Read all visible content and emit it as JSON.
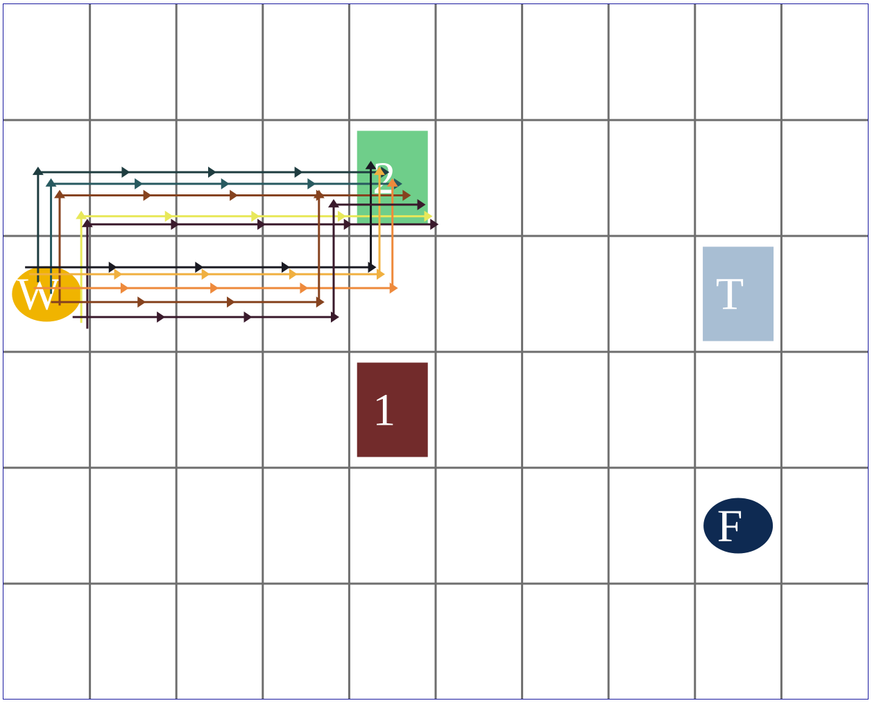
{
  "grid": {
    "cols": 10,
    "rows": 6,
    "border_color": "#1a1aa0",
    "line_color": "#6e6e6e"
  },
  "pieces": [
    {
      "id": "piece-w",
      "label": "W",
      "shape": "ellipse",
      "fill": "#f0b400",
      "text_color": "#ffffff",
      "cell": [
        0,
        2
      ]
    },
    {
      "id": "piece-2",
      "label": "2",
      "shape": "rect",
      "fill": "#6fce8a",
      "text_color": "#ffffff",
      "cell": [
        4,
        1
      ]
    },
    {
      "id": "piece-t",
      "label": "T",
      "shape": "rect",
      "fill": "#a8bed3",
      "text_color": "#ffffff",
      "cell": [
        8,
        2
      ]
    },
    {
      "id": "piece-1",
      "label": "1",
      "shape": "rect",
      "fill": "#722b2b",
      "text_color": "#ffffff",
      "cell": [
        4,
        3
      ]
    },
    {
      "id": "piece-f",
      "label": "F",
      "shape": "ellipse",
      "fill": "#0e2a52",
      "text_color": "#ffffff",
      "cell": [
        8,
        4
      ]
    }
  ],
  "paths": [
    {
      "color": "#1f3d40",
      "points": [
        [
          0.4,
          2.4
        ],
        [
          0.4,
          1.45
        ],
        [
          4.4,
          1.45
        ]
      ]
    },
    {
      "color": "#285a60",
      "points": [
        [
          0.55,
          2.5
        ],
        [
          0.55,
          1.55
        ],
        [
          4.55,
          1.55
        ]
      ]
    },
    {
      "color": "#86431f",
      "points": [
        [
          0.65,
          2.6
        ],
        [
          0.65,
          1.65
        ],
        [
          4.65,
          1.65
        ]
      ]
    },
    {
      "color": "#e8e85a",
      "points": [
        [
          0.9,
          2.75
        ],
        [
          0.9,
          1.83
        ],
        [
          4.9,
          1.83
        ]
      ]
    },
    {
      "color": "#3a1a2c",
      "points": [
        [
          0.97,
          2.8
        ],
        [
          0.97,
          1.9
        ],
        [
          4.97,
          1.9
        ]
      ]
    },
    {
      "color": "#1a1a22",
      "points": [
        [
          0.25,
          2.27
        ],
        [
          4.25,
          2.27
        ],
        [
          4.25,
          1.4
        ]
      ]
    },
    {
      "color": "#f0b040",
      "points": [
        [
          0.3,
          2.33
        ],
        [
          4.35,
          2.33
        ],
        [
          4.35,
          1.45
        ]
      ]
    },
    {
      "color": "#ee8a3c",
      "points": [
        [
          0.35,
          2.45
        ],
        [
          4.5,
          2.45
        ],
        [
          4.5,
          1.55
        ]
      ]
    },
    {
      "color": "#86431f",
      "points": [
        [
          0.55,
          2.57
        ],
        [
          3.65,
          2.57
        ],
        [
          3.65,
          1.65
        ]
      ]
    },
    {
      "color": "#3a1a2c",
      "points": [
        [
          0.8,
          2.7
        ],
        [
          3.82,
          2.7
        ],
        [
          3.82,
          1.73
        ],
        [
          4.82,
          1.73
        ]
      ]
    }
  ]
}
